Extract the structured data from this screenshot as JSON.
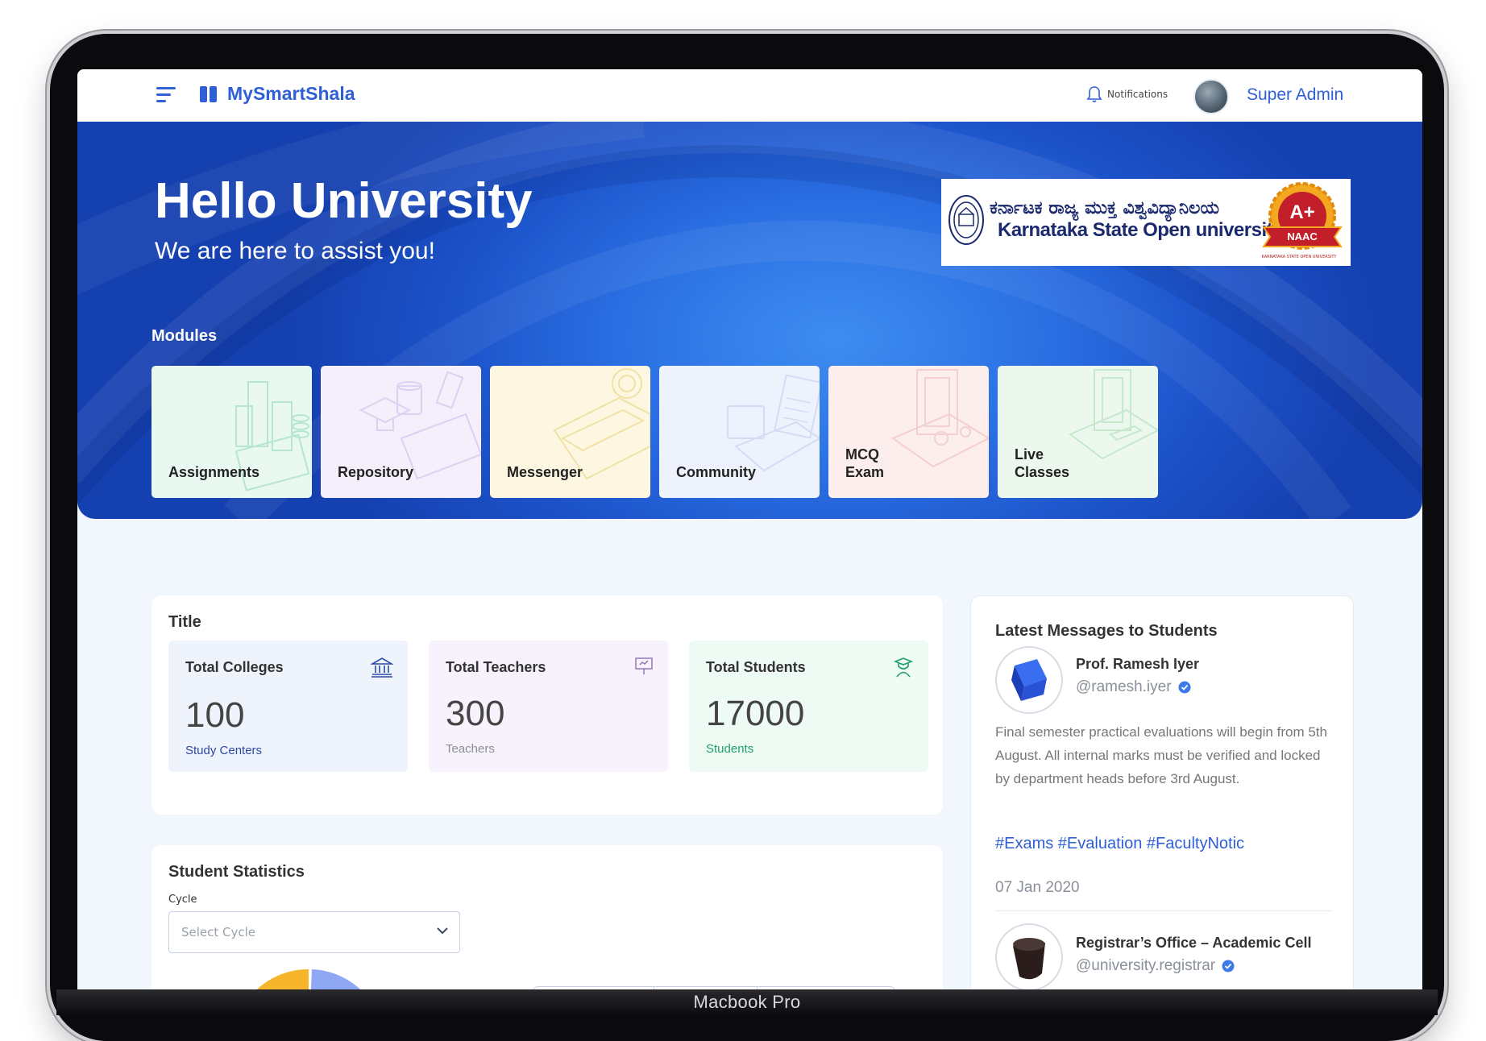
{
  "device_label": "Macbook Pro",
  "header": {
    "brand": "MySmartShala",
    "notifications_label": "Notifications",
    "user_name": "Super Admin"
  },
  "hero": {
    "title": "Hello University",
    "subtitle": "We are here to assist you!",
    "university_name_kannada": "ಕರ್ನಾಟಕ ರಾಜ್ಯ ಮುಕ್ತ ವಿಶ್ವವಿದ್ಯಾನಿಲಯ",
    "university_name_english": "Karnataka State Open university",
    "naac_grade": "A+",
    "naac_label": "NAAC",
    "naac_footer": "KARNATAKA STATE OPEN UNIVERSITY",
    "modules_label": "Modules",
    "modules": [
      {
        "label": "Assignments",
        "color": "#e9f8f1",
        "line": "#b6e6cf"
      },
      {
        "label": "Repository",
        "color": "#f4effb",
        "line": "#ddd0f0"
      },
      {
        "label": "Messenger",
        "color": "#fdf7e1",
        "line": "#f1e1a6"
      },
      {
        "label": "Community",
        "color": "#eef2fc",
        "line": "#d2dcf4"
      },
      {
        "label": "MCQ\nExam",
        "color": "#fdeeee",
        "line": "#f4cfcf"
      },
      {
        "label": "Live\nClasses",
        "color": "#ecf8ee",
        "line": "#c6e8cc"
      }
    ]
  },
  "stats": {
    "title": "Title",
    "items": [
      {
        "label": "Total Colleges",
        "value": "100",
        "unit": "Study Centers",
        "bg": "#eff3fb",
        "unit_color": "#2b4aa8",
        "icon": "bank-icon"
      },
      {
        "label": "Total Teachers",
        "value": "300",
        "unit": "Teachers",
        "bg": "#f7f2fb",
        "unit_color": "#8b8f97",
        "icon": "presentation-icon"
      },
      {
        "label": "Total Students",
        "value": "17000",
        "unit": "Students",
        "bg": "#eefaf4",
        "unit_color": "#22a06b",
        "icon": "student-icon"
      }
    ]
  },
  "student_statistics": {
    "title": "Student Statistics",
    "cycle_label": "Cycle",
    "cycle_placeholder": "Select Cycle"
  },
  "messages": {
    "title": "Latest Messages to Students",
    "items": [
      {
        "name": "Prof. Ramesh Iyer",
        "handle": "@ramesh.iyer",
        "body": "Final semester practical evaluations will begin from 5th August. All internal marks must be verified and locked by department heads before 3rd August.",
        "tags": "#Exams #Evaluation #FacultyNotic",
        "date": "07 Jan 2020"
      },
      {
        "name": "Registrar’s Office – Academic Cell",
        "handle": "@university.registrar"
      }
    ]
  }
}
